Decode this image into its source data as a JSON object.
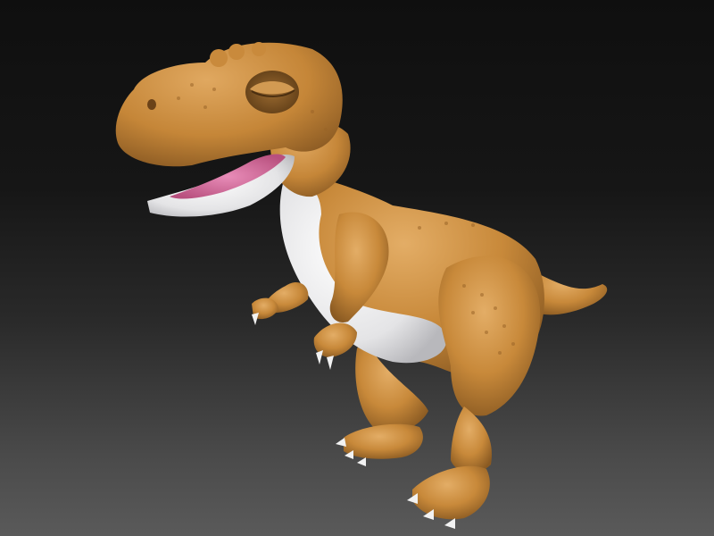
{
  "scene": {
    "subject": "cartoon-trex-sculpt",
    "colors": {
      "background_top": "#0f0f0f",
      "background_bottom": "#5a5a5a",
      "skin": "#c8893a",
      "skin_light": "#dca35a",
      "skin_dark": "#8a5a22",
      "belly": "#e8e8ea",
      "mouth": "#d97aa8",
      "claw": "#f2f2f2"
    }
  }
}
